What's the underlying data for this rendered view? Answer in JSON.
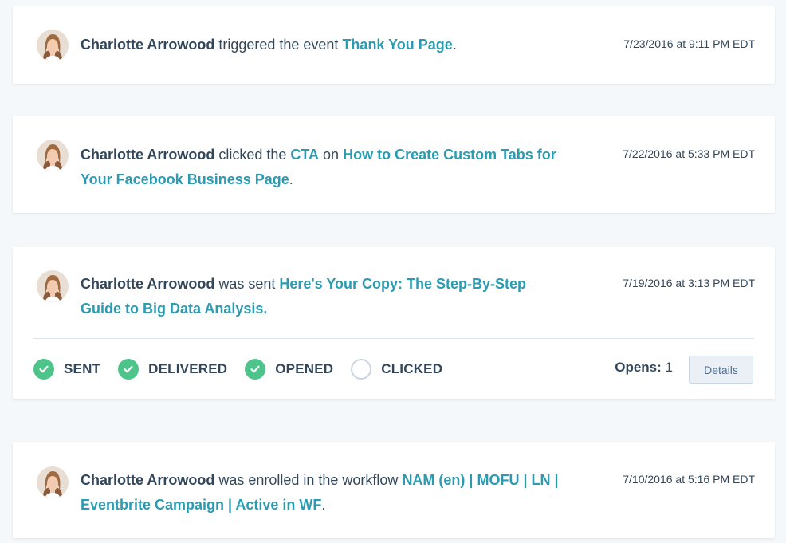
{
  "events": [
    {
      "person": "Charlotte Arrowood",
      "verb": " triggered the event ",
      "link1": "Thank You Page",
      "mid": "",
      "link2": "",
      "end": ".",
      "timestamp": "7/23/2016 at 9:11 PM EDT"
    },
    {
      "person": "Charlotte Arrowood",
      "verb": " clicked the ",
      "link1": "CTA",
      "mid": " on ",
      "link2": "How to Create Custom Tabs for Your Facebook Business Page",
      "end": ".",
      "timestamp": "7/22/2016 at 5:33 PM EDT"
    },
    {
      "person": "Charlotte Arrowood",
      "verb": " was sent ",
      "link1": "Here's Your Copy: The Step-By-Step Guide to Big Data Analysis.",
      "mid": "",
      "link2": "",
      "end": "",
      "timestamp": "7/19/2016 at 3:13 PM EDT",
      "statuses": [
        {
          "label": "SENT",
          "done": true
        },
        {
          "label": "DELIVERED",
          "done": true
        },
        {
          "label": "OPENED",
          "done": true
        },
        {
          "label": "CLICKED",
          "done": false
        }
      ],
      "opens_label": "Opens:",
      "opens_value": "1",
      "details_label": "Details"
    },
    {
      "person": "Charlotte Arrowood",
      "verb": " was enrolled in the workflow ",
      "link1": "NAM (en) | MOFU | LN | Eventbrite Campaign | Active in WF",
      "mid": "",
      "link2": "",
      "end": ".",
      "timestamp": "7/10/2016 at 5:16 PM EDT"
    }
  ],
  "colors": {
    "link": "#2b9bb2",
    "text": "#33475b",
    "success": "#4ec48a",
    "background": "#f5f8fa"
  },
  "icons": {
    "avatar": "contact-avatar",
    "check": "check-icon",
    "empty": "empty-circle-icon"
  }
}
